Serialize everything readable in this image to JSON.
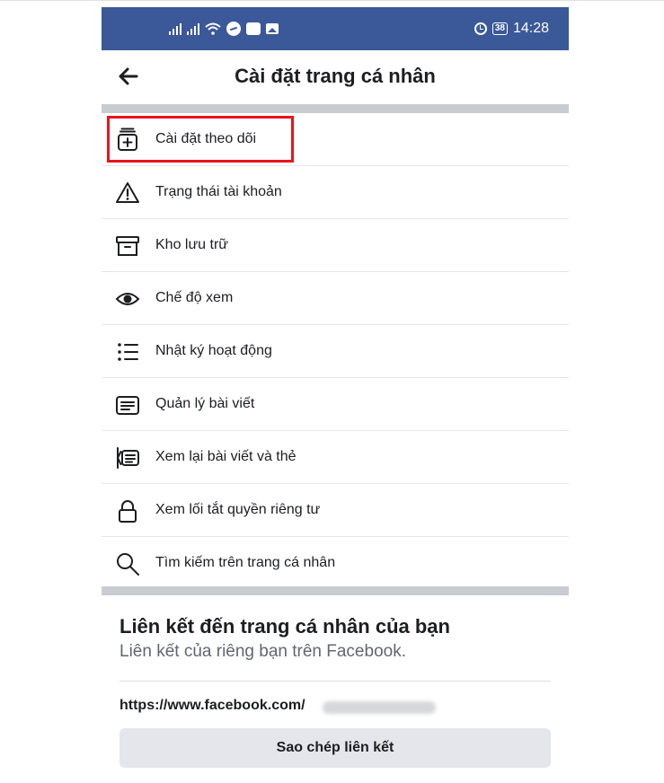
{
  "status_bar": {
    "time": "14:28",
    "battery": "38"
  },
  "header": {
    "title": "Cài đặt trang cá nhân"
  },
  "menu": {
    "items": [
      {
        "label": "Cài đặt theo dõi",
        "icon": "follow-settings-icon"
      },
      {
        "label": "Trạng thái tài khoản",
        "icon": "warning-icon"
      },
      {
        "label": "Kho lưu trữ",
        "icon": "archive-icon"
      },
      {
        "label": "Chế độ xem",
        "icon": "eye-icon"
      },
      {
        "label": "Nhật ký hoạt động",
        "icon": "list-icon"
      },
      {
        "label": "Quản lý bài viết",
        "icon": "posts-icon"
      },
      {
        "label": "Xem lại bài viết và thẻ",
        "icon": "review-tags-icon"
      },
      {
        "label": "Xem lối tắt quyền riêng tư",
        "icon": "lock-icon"
      },
      {
        "label": "Tìm kiếm trên trang cá nhân",
        "icon": "search-icon"
      }
    ]
  },
  "profile_link": {
    "title": "Liên kết đến trang cá nhân của bạn",
    "subtitle": "Liên kết của riêng bạn trên Facebook.",
    "url": "https://www.facebook.com/",
    "copy_label": "Sao chép liên kết"
  },
  "colors": {
    "brand": "#3b5998",
    "highlight": "#e8141c",
    "divider": "#c9ccd1"
  }
}
